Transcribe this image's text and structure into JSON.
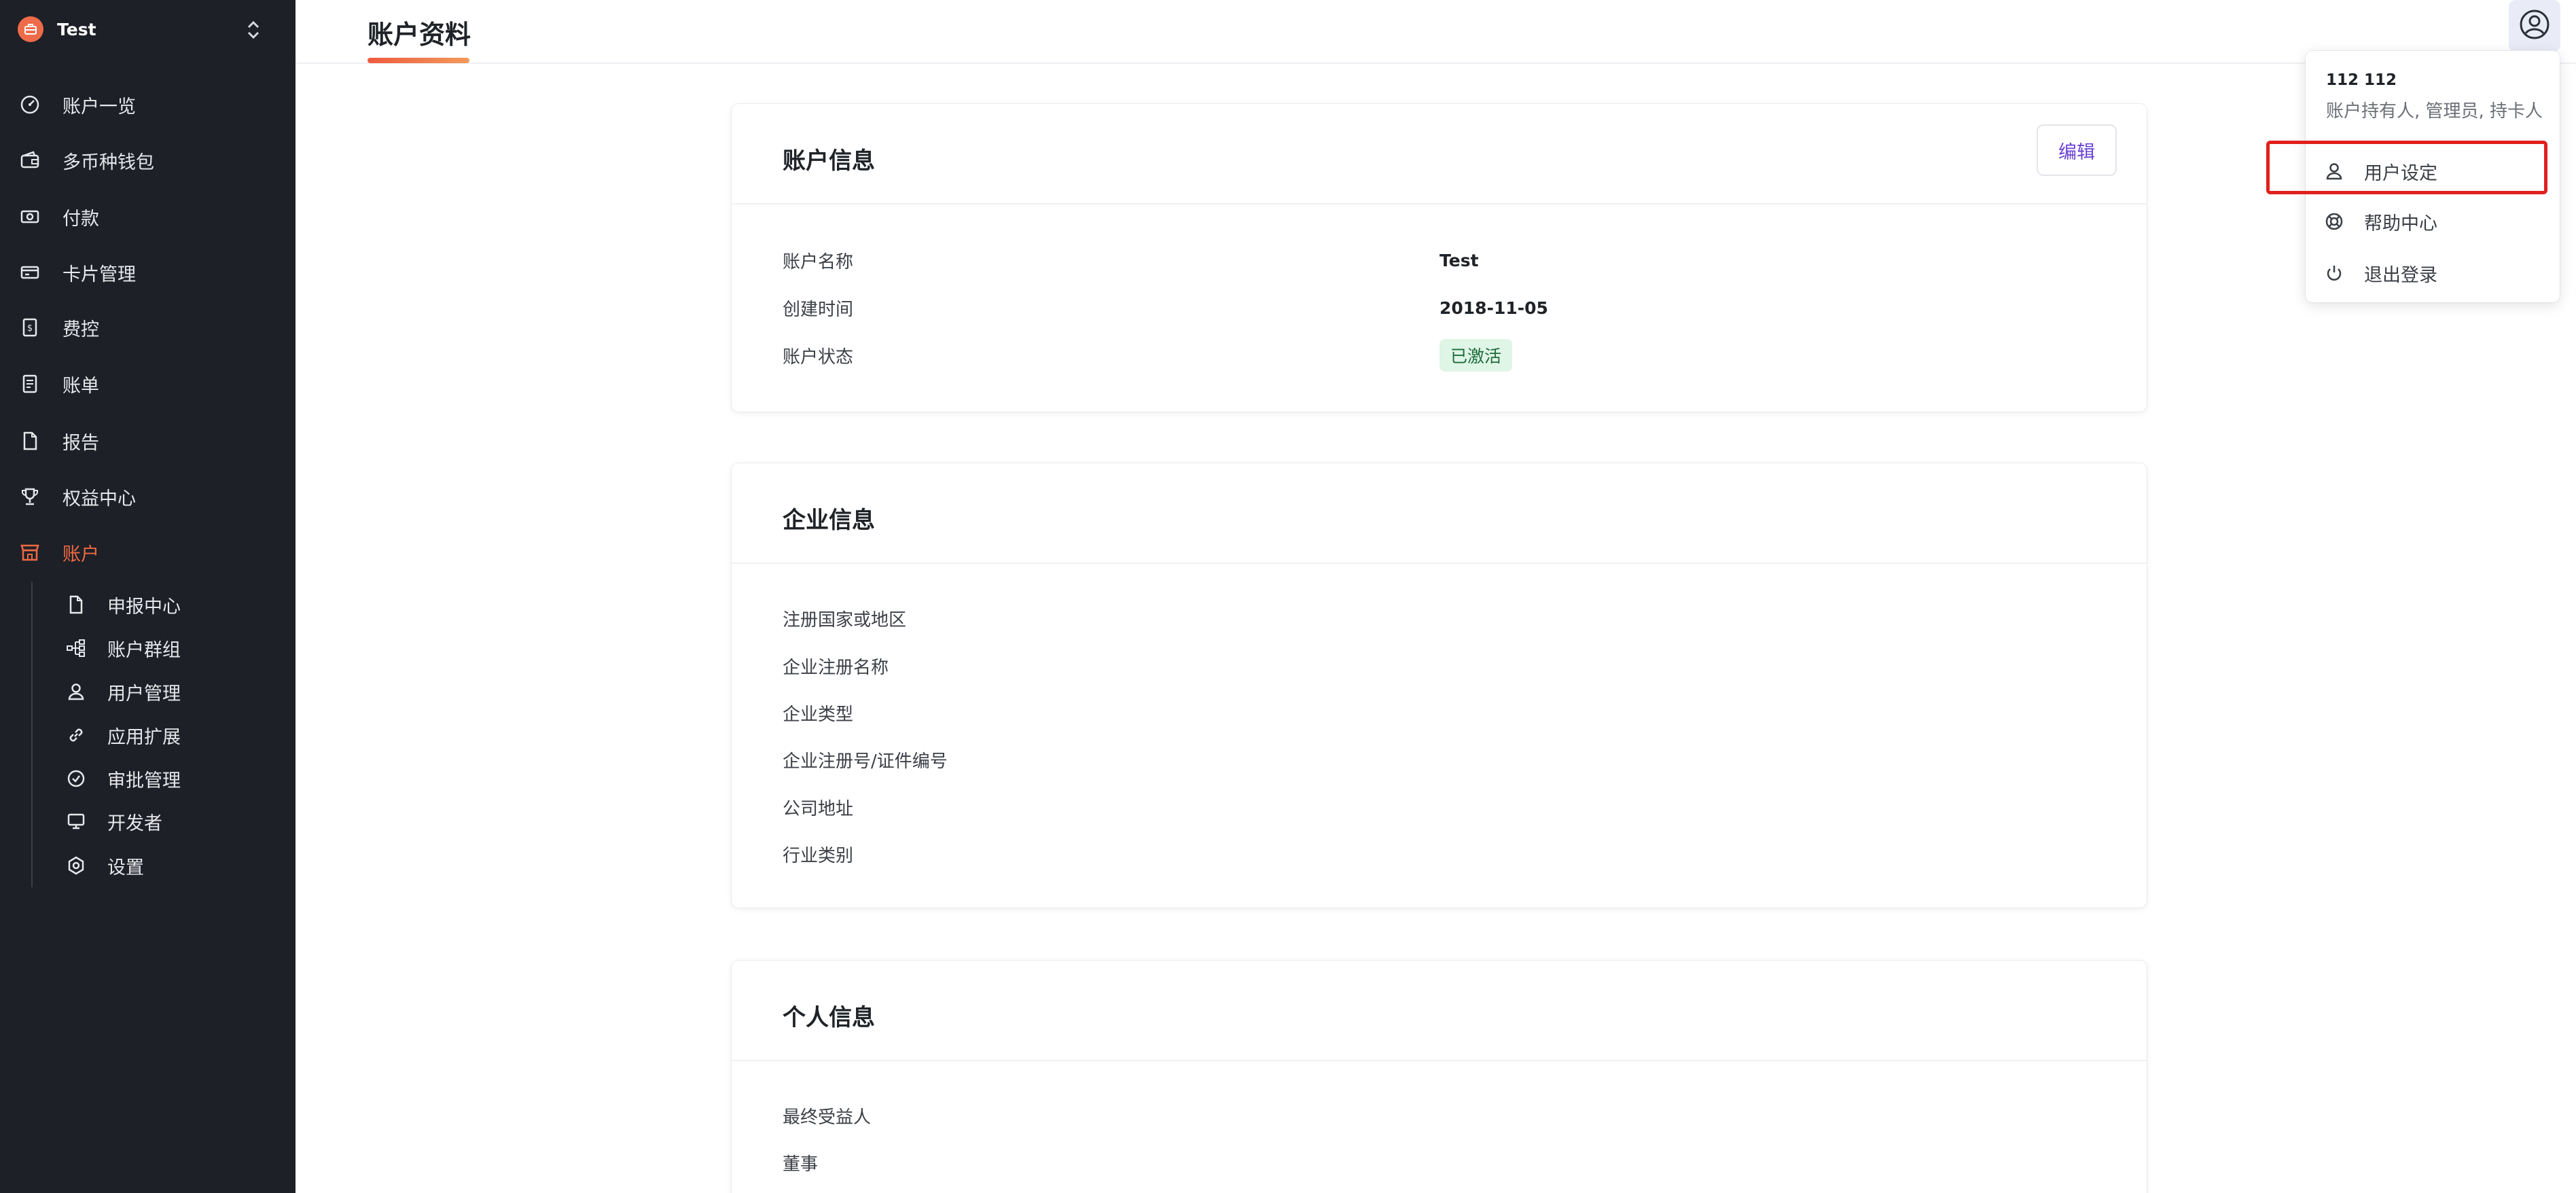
{
  "org": {
    "name": "Test"
  },
  "sidebar": {
    "items": [
      {
        "label": "账户一览",
        "icon": "dashboard-icon"
      },
      {
        "label": "多币种钱包",
        "icon": "wallet-icon"
      },
      {
        "label": "付款",
        "icon": "payment-icon"
      },
      {
        "label": "卡片管理",
        "icon": "card-icon"
      },
      {
        "label": "费控",
        "icon": "expense-icon"
      },
      {
        "label": "账单",
        "icon": "bill-icon"
      },
      {
        "label": "报告",
        "icon": "report-icon"
      },
      {
        "label": "权益中心",
        "icon": "trophy-icon"
      },
      {
        "label": "账户",
        "icon": "store-icon",
        "active": true
      }
    ],
    "subitems": [
      {
        "label": "申报中心",
        "icon": "document-icon"
      },
      {
        "label": "账户群组",
        "icon": "group-icon"
      },
      {
        "label": "用户管理",
        "icon": "user-icon"
      },
      {
        "label": "应用扩展",
        "icon": "link-icon"
      },
      {
        "label": "审批管理",
        "icon": "check-circle-icon"
      },
      {
        "label": "开发者",
        "icon": "monitor-icon"
      },
      {
        "label": "设置",
        "icon": "gear-icon"
      }
    ]
  },
  "header": {
    "title": "账户资料"
  },
  "account_info": {
    "title": "账户信息",
    "edit_label": "编辑",
    "rows": [
      {
        "label": "账户名称",
        "value": "Test"
      },
      {
        "label": "创建时间",
        "value": "2018-11-05"
      },
      {
        "label": "账户状态",
        "value": "已激活"
      }
    ]
  },
  "company_info": {
    "title": "企业信息",
    "rows": [
      {
        "label": "注册国家或地区"
      },
      {
        "label": "企业注册名称"
      },
      {
        "label": "企业类型"
      },
      {
        "label": "企业注册号/证件编号"
      },
      {
        "label": "公司地址"
      },
      {
        "label": "行业类别"
      }
    ]
  },
  "personal_info": {
    "title": "个人信息",
    "rows": [
      {
        "label": "最终受益人"
      },
      {
        "label": "董事"
      }
    ]
  },
  "user_menu": {
    "name": "112 112",
    "roles": "账户持有人, 管理员, 持卡人",
    "items": [
      {
        "label": "用户设定",
        "icon": "user-icon"
      },
      {
        "label": "帮助中心",
        "icon": "lifebuoy-icon"
      },
      {
        "label": "退出登录",
        "icon": "power-icon"
      }
    ]
  },
  "colors": {
    "sidebar_bg": "#1d2027",
    "accent": "#ef6a44",
    "edit_text": "#6a42d6",
    "badge_bg": "#dff5e6",
    "highlight": "#e0201e"
  }
}
